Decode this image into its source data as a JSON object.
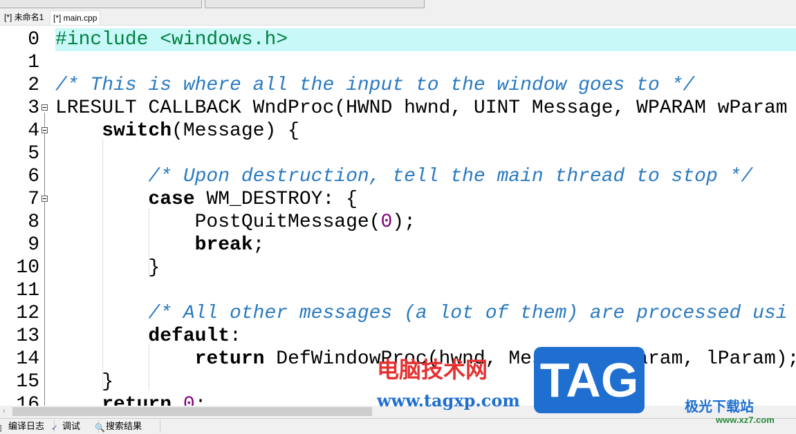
{
  "tabs": [
    {
      "label": "[*] 未命名1",
      "active": false
    },
    {
      "label": "[*] main.cpp",
      "active": true
    }
  ],
  "editor": {
    "highlight_line": 0,
    "lines": [
      {
        "n": "0",
        "fold": false,
        "tokens": [
          [
            "pp",
            "#include <windows.h>"
          ]
        ]
      },
      {
        "n": "1",
        "fold": false,
        "tokens": []
      },
      {
        "n": "2",
        "fold": false,
        "tokens": [
          [
            "cm",
            "/* This is where all the input to the window goes to */"
          ]
        ]
      },
      {
        "n": "3",
        "fold": true,
        "tokens": [
          [
            "",
            "LRESULT CALLBACK WndProc(HWND hwnd, UINT Message, WPARAM wParam"
          ]
        ]
      },
      {
        "n": "4",
        "fold": true,
        "tokens": [
          [
            "",
            "    "
          ],
          [
            "kw",
            "switch"
          ],
          [
            "",
            "(Message) {"
          ]
        ]
      },
      {
        "n": "5",
        "fold": false,
        "tokens": []
      },
      {
        "n": "6",
        "fold": false,
        "tokens": [
          [
            "",
            "        "
          ],
          [
            "cm",
            "/* Upon destruction, tell the main thread to stop */"
          ]
        ]
      },
      {
        "n": "7",
        "fold": true,
        "tokens": [
          [
            "",
            "        "
          ],
          [
            "kw",
            "case"
          ],
          [
            "",
            " WM_DESTROY: {"
          ]
        ]
      },
      {
        "n": "8",
        "fold": false,
        "tokens": [
          [
            "",
            "            PostQuitMessage("
          ],
          [
            "num",
            "0"
          ],
          [
            "",
            ");"
          ]
        ]
      },
      {
        "n": "9",
        "fold": false,
        "tokens": [
          [
            "",
            "            "
          ],
          [
            "kw",
            "break"
          ],
          [
            "",
            ";"
          ]
        ]
      },
      {
        "n": "10",
        "fold": false,
        "tokens": [
          [
            "",
            "        }"
          ]
        ]
      },
      {
        "n": "11",
        "fold": false,
        "tokens": []
      },
      {
        "n": "12",
        "fold": false,
        "tokens": [
          [
            "",
            "        "
          ],
          [
            "cm",
            "/* All other messages (a lot of them) are processed usi"
          ]
        ]
      },
      {
        "n": "13",
        "fold": false,
        "tokens": [
          [
            "",
            "        "
          ],
          [
            "kw",
            "default"
          ],
          [
            "",
            ":"
          ]
        ]
      },
      {
        "n": "14",
        "fold": false,
        "tokens": [
          [
            "",
            "            "
          ],
          [
            "kw",
            "return"
          ],
          [
            "",
            " DefWindowProc(hwnd, Message, wParam, lParam);"
          ]
        ]
      },
      {
        "n": "15",
        "fold": false,
        "tokens": [
          [
            "",
            "    }"
          ]
        ]
      },
      {
        "n": "16",
        "fold": false,
        "tokens": [
          [
            "",
            "    "
          ],
          [
            "kw",
            "return"
          ],
          [
            "",
            " "
          ],
          [
            "num",
            "0"
          ],
          [
            "",
            ";"
          ]
        ]
      }
    ]
  },
  "bottom_tabs": [
    {
      "label": "编译日志",
      "icon": "compile-log-icon"
    },
    {
      "label": "调试",
      "icon": "debug-check-icon"
    },
    {
      "label": "搜索结果",
      "icon": "search-results-icon"
    }
  ],
  "watermark": {
    "site_cn": "电脑技术网",
    "site_url": "www.tagxp.com",
    "logo": "TAG",
    "site2_cn": "极光下载站",
    "site2_url": "www.xz7.com"
  }
}
